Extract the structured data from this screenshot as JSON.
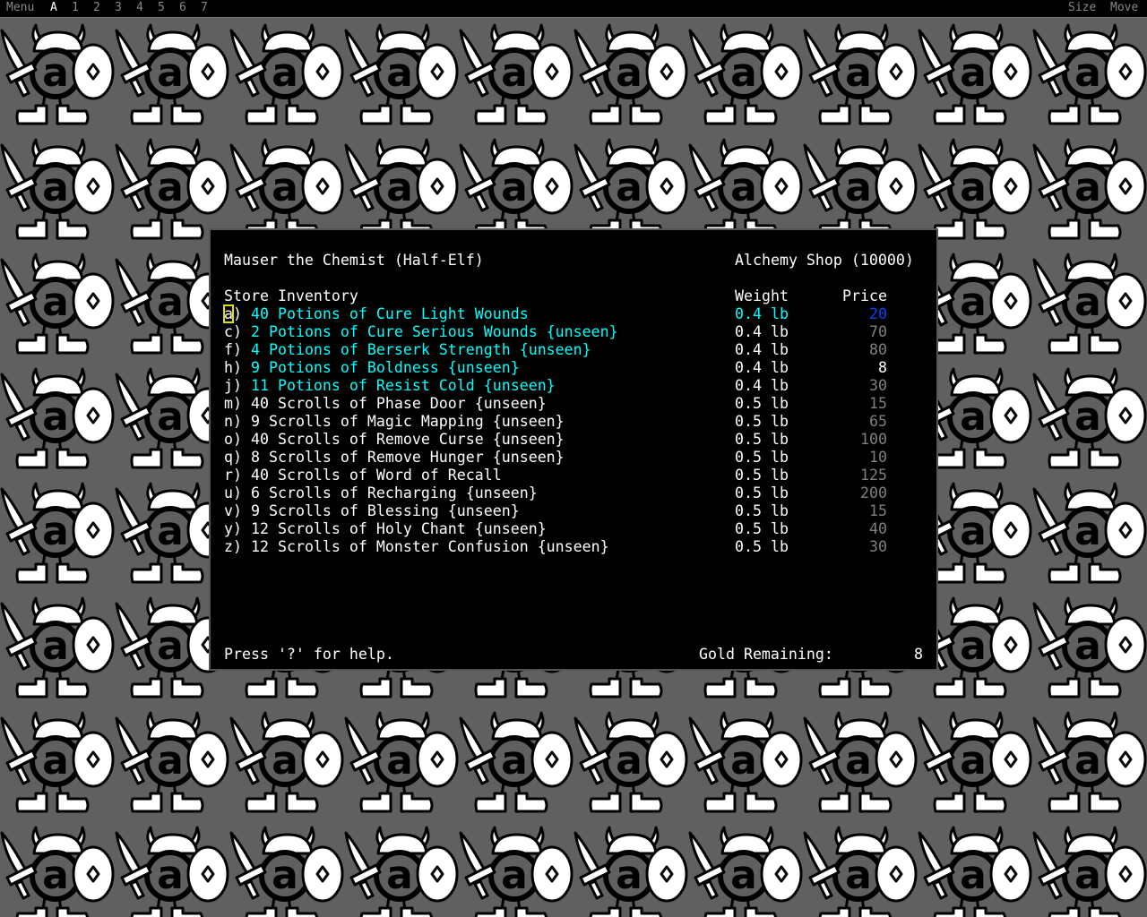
{
  "topbar": {
    "left": [
      "Menu",
      "A",
      "1",
      "2",
      "3",
      "4",
      "5",
      "6",
      "7"
    ],
    "right": [
      "Size",
      "Move"
    ]
  },
  "store": {
    "owner": "Mauser the Chemist (Half-Elf)",
    "shop": "Alchemy Shop (10000)",
    "inventory_label": "Store Inventory",
    "weight_header": "Weight",
    "price_header": "Price",
    "items": [
      {
        "key": "a)",
        "name": "40 Potions of Cure Light Wounds",
        "weight": "0.4 lb",
        "price": "20",
        "name_color": "cyan",
        "weight_color": "cyan",
        "price_color": "blue",
        "selected": true
      },
      {
        "key": "c)",
        "name": "2 Potions of Cure Serious Wounds {unseen}",
        "weight": "0.4 lb",
        "price": "70",
        "name_color": "cyan",
        "price_color": "grey"
      },
      {
        "key": "f)",
        "name": "4 Potions of Berserk Strength {unseen}",
        "weight": "0.4 lb",
        "price": "80",
        "name_color": "cyan",
        "price_color": "grey"
      },
      {
        "key": "h)",
        "name": "9 Potions of Boldness {unseen}",
        "weight": "0.4 lb",
        "price": "8",
        "name_color": "cyan",
        "price_color": "white"
      },
      {
        "key": "j)",
        "name": "11 Potions of Resist Cold {unseen}",
        "weight": "0.4 lb",
        "price": "30",
        "name_color": "cyan",
        "price_color": "grey"
      },
      {
        "key": "m)",
        "name": "40 Scrolls of Phase Door {unseen}",
        "weight": "0.5 lb",
        "price": "15",
        "price_color": "grey"
      },
      {
        "key": "n)",
        "name": "9 Scrolls of Magic Mapping {unseen}",
        "weight": "0.5 lb",
        "price": "65",
        "price_color": "grey"
      },
      {
        "key": "o)",
        "name": "40 Scrolls of Remove Curse {unseen}",
        "weight": "0.5 lb",
        "price": "100",
        "price_color": "grey"
      },
      {
        "key": "q)",
        "name": "8 Scrolls of Remove Hunger {unseen}",
        "weight": "0.5 lb",
        "price": "10",
        "price_color": "grey"
      },
      {
        "key": "r)",
        "name": "40 Scrolls of Word of Recall",
        "weight": "0.5 lb",
        "price": "125",
        "price_color": "grey"
      },
      {
        "key": "u)",
        "name": "6 Scrolls of Recharging {unseen}",
        "weight": "0.5 lb",
        "price": "200",
        "price_color": "grey"
      },
      {
        "key": "v)",
        "name": "9 Scrolls of Blessing {unseen}",
        "weight": "0.5 lb",
        "price": "15",
        "price_color": "grey"
      },
      {
        "key": "y)",
        "name": "12 Scrolls of Holy Chant {unseen}",
        "weight": "0.5 lb",
        "price": "40",
        "price_color": "grey"
      },
      {
        "key": "z)",
        "name": "12 Scrolls of Monster Confusion {unseen}",
        "weight": "0.5 lb",
        "price": "30",
        "price_color": "grey"
      }
    ],
    "help": "Press '?' for help.",
    "gold_label": "Gold Remaining:",
    "gold": "8"
  },
  "colors": {
    "cyan": "#00ffff",
    "grey": "#808080",
    "blue": "#0044ff",
    "white": "#ffffff",
    "cursor": "#e0e000"
  }
}
